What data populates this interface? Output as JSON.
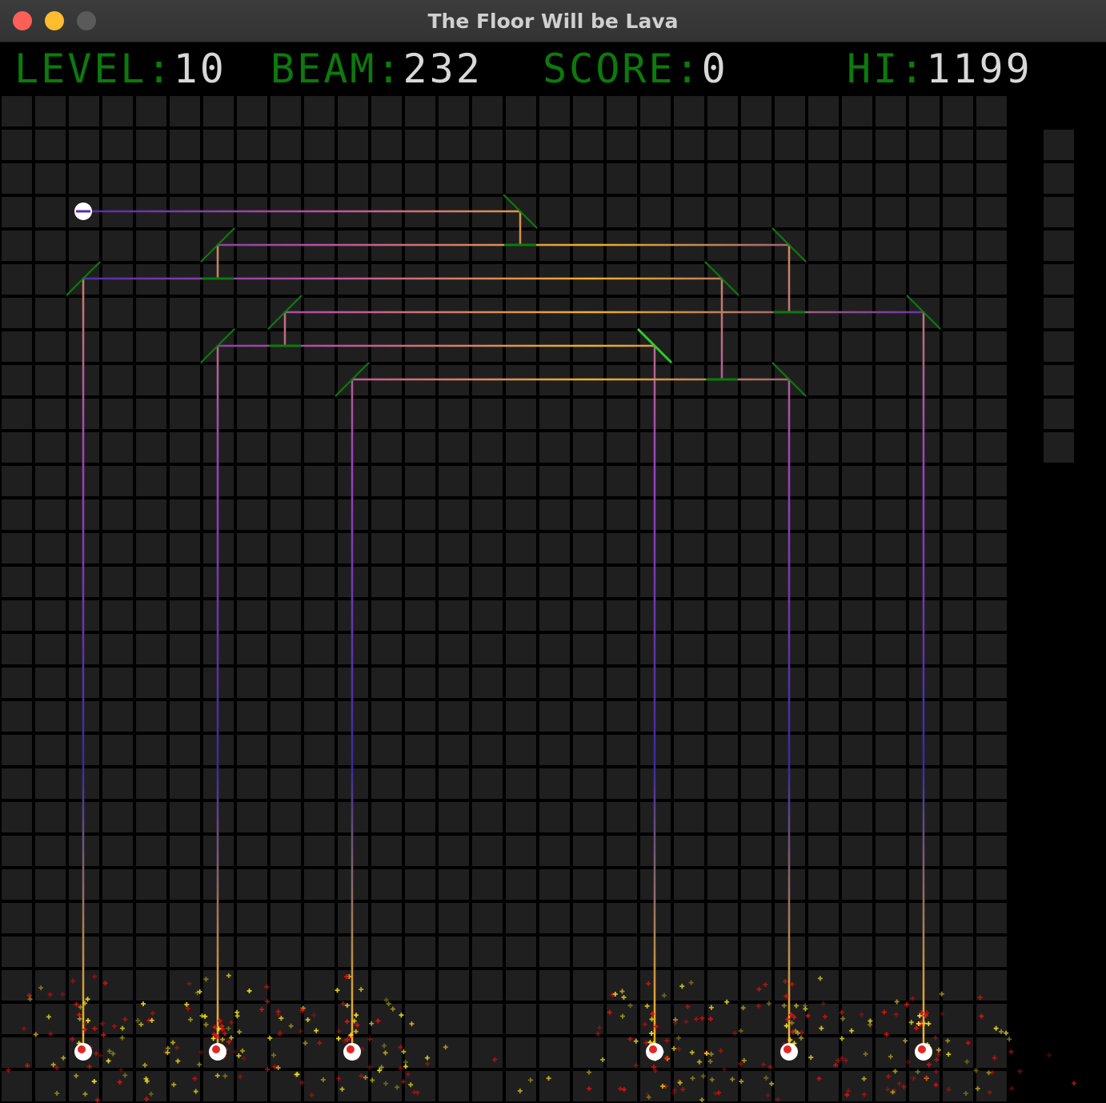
{
  "window": {
    "title": "The Floor Will be Lava"
  },
  "hud": {
    "level": {
      "label": "LEVEL:",
      "value": "10"
    },
    "beam": {
      "label": "BEAM:",
      "value": "232"
    },
    "score": {
      "label": "SCORE:",
      "value": "0"
    },
    "hi": {
      "label": "HI:",
      "value": "1199"
    }
  },
  "colors": {
    "grid_bg": "#000000",
    "cell": "#1f1f1f",
    "mirror": "#0c7a0c",
    "mirror_active": "#2ecc2e",
    "beam_a": "#f0b02a",
    "beam_b": "#3a1f9a",
    "spark_red": "#e01010",
    "spark_yellow": "#e8d820",
    "hud_label": "#0c7a0c",
    "hud_value": "#d8d8d8"
  },
  "board": {
    "cols": 30,
    "rows": 30,
    "side_panel_slots": 10,
    "source": [
      2,
      3
    ]
  },
  "mirrors": [
    {
      "cell": [
        15,
        3
      ],
      "dir": "\\",
      "active": false
    },
    {
      "cell": [
        6,
        4
      ],
      "dir": "/",
      "active": false
    },
    {
      "cell": [
        23,
        4
      ],
      "dir": "\\",
      "active": false
    },
    {
      "cell": [
        2,
        5
      ],
      "dir": "/",
      "active": false
    },
    {
      "cell": [
        21,
        5
      ],
      "dir": "\\",
      "active": false
    },
    {
      "cell": [
        8,
        6
      ],
      "dir": "/",
      "active": false
    },
    {
      "cell": [
        27,
        6
      ],
      "dir": "\\",
      "active": false
    },
    {
      "cell": [
        6,
        7
      ],
      "dir": "/",
      "active": false
    },
    {
      "cell": [
        19,
        7
      ],
      "dir": "\\",
      "active": true
    },
    {
      "cell": [
        10,
        8
      ],
      "dir": "/",
      "active": false
    },
    {
      "cell": [
        23,
        8
      ],
      "dir": "\\",
      "active": false
    }
  ],
  "splitters": [
    [
      15,
      4
    ],
    [
      6,
      5
    ],
    [
      23,
      6
    ],
    [
      8,
      7
    ],
    [
      21,
      8
    ]
  ],
  "targets": [
    [
      2,
      28
    ],
    [
      6,
      28
    ],
    [
      10,
      28
    ],
    [
      19,
      28
    ],
    [
      23,
      28
    ],
    [
      27,
      28
    ]
  ],
  "beam_paths": [
    [
      [
        2,
        3
      ],
      [
        15,
        3
      ],
      [
        15,
        4
      ],
      [
        23,
        4
      ],
      [
        23,
        6
      ],
      [
        27,
        6
      ],
      [
        27,
        28
      ]
    ],
    [
      [
        15,
        4
      ],
      [
        6,
        4
      ],
      [
        6,
        5
      ],
      [
        2,
        5
      ],
      [
        2,
        28
      ]
    ],
    [
      [
        6,
        5
      ],
      [
        21,
        5
      ],
      [
        21,
        8
      ],
      [
        23,
        8
      ],
      [
        23,
        28
      ]
    ],
    [
      [
        23,
        6
      ],
      [
        8,
        6
      ],
      [
        8,
        7
      ],
      [
        6,
        7
      ],
      [
        6,
        28
      ]
    ],
    [
      [
        8,
        7
      ],
      [
        19,
        7
      ],
      [
        19,
        28
      ]
    ],
    [
      [
        21,
        8
      ],
      [
        10,
        8
      ],
      [
        10,
        28
      ]
    ]
  ]
}
